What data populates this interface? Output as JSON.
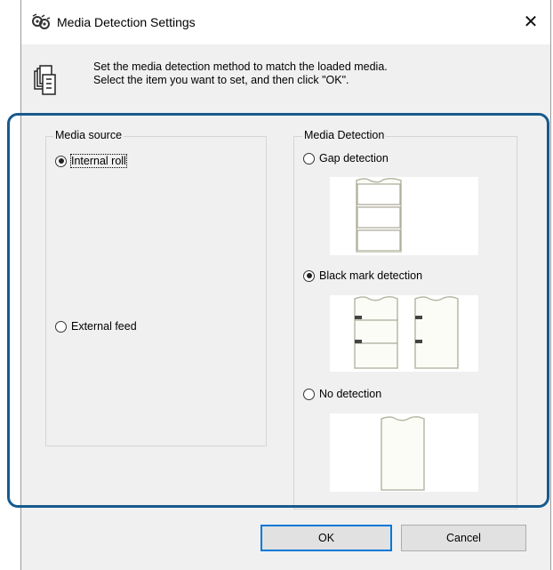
{
  "window": {
    "title": "Media Detection Settings",
    "close_glyph": "✕"
  },
  "info": {
    "icon": "media-roll-icon",
    "line1": "Set the media detection method to match the loaded media.",
    "line2": "Select the item you want to set, and then click \"OK\"."
  },
  "media_source": {
    "label": "Media source",
    "options": [
      {
        "label": "Internal roll",
        "checked": true
      },
      {
        "label": "External feed",
        "checked": false
      }
    ]
  },
  "media_detection": {
    "label": "Media Detection",
    "options": [
      {
        "label": "Gap detection",
        "checked": false,
        "illustration": "gap-media-illustration"
      },
      {
        "label": "Black mark detection",
        "checked": true,
        "illustration": "black-mark-media-illustration"
      },
      {
        "label": "No detection",
        "checked": false,
        "illustration": "continuous-media-illustration"
      }
    ]
  },
  "buttons": {
    "ok": "OK",
    "cancel": "Cancel"
  },
  "colors": {
    "highlight": "#175a8e",
    "default_button_border": "#0078d7",
    "dialog_bg": "#f0f0f0"
  }
}
